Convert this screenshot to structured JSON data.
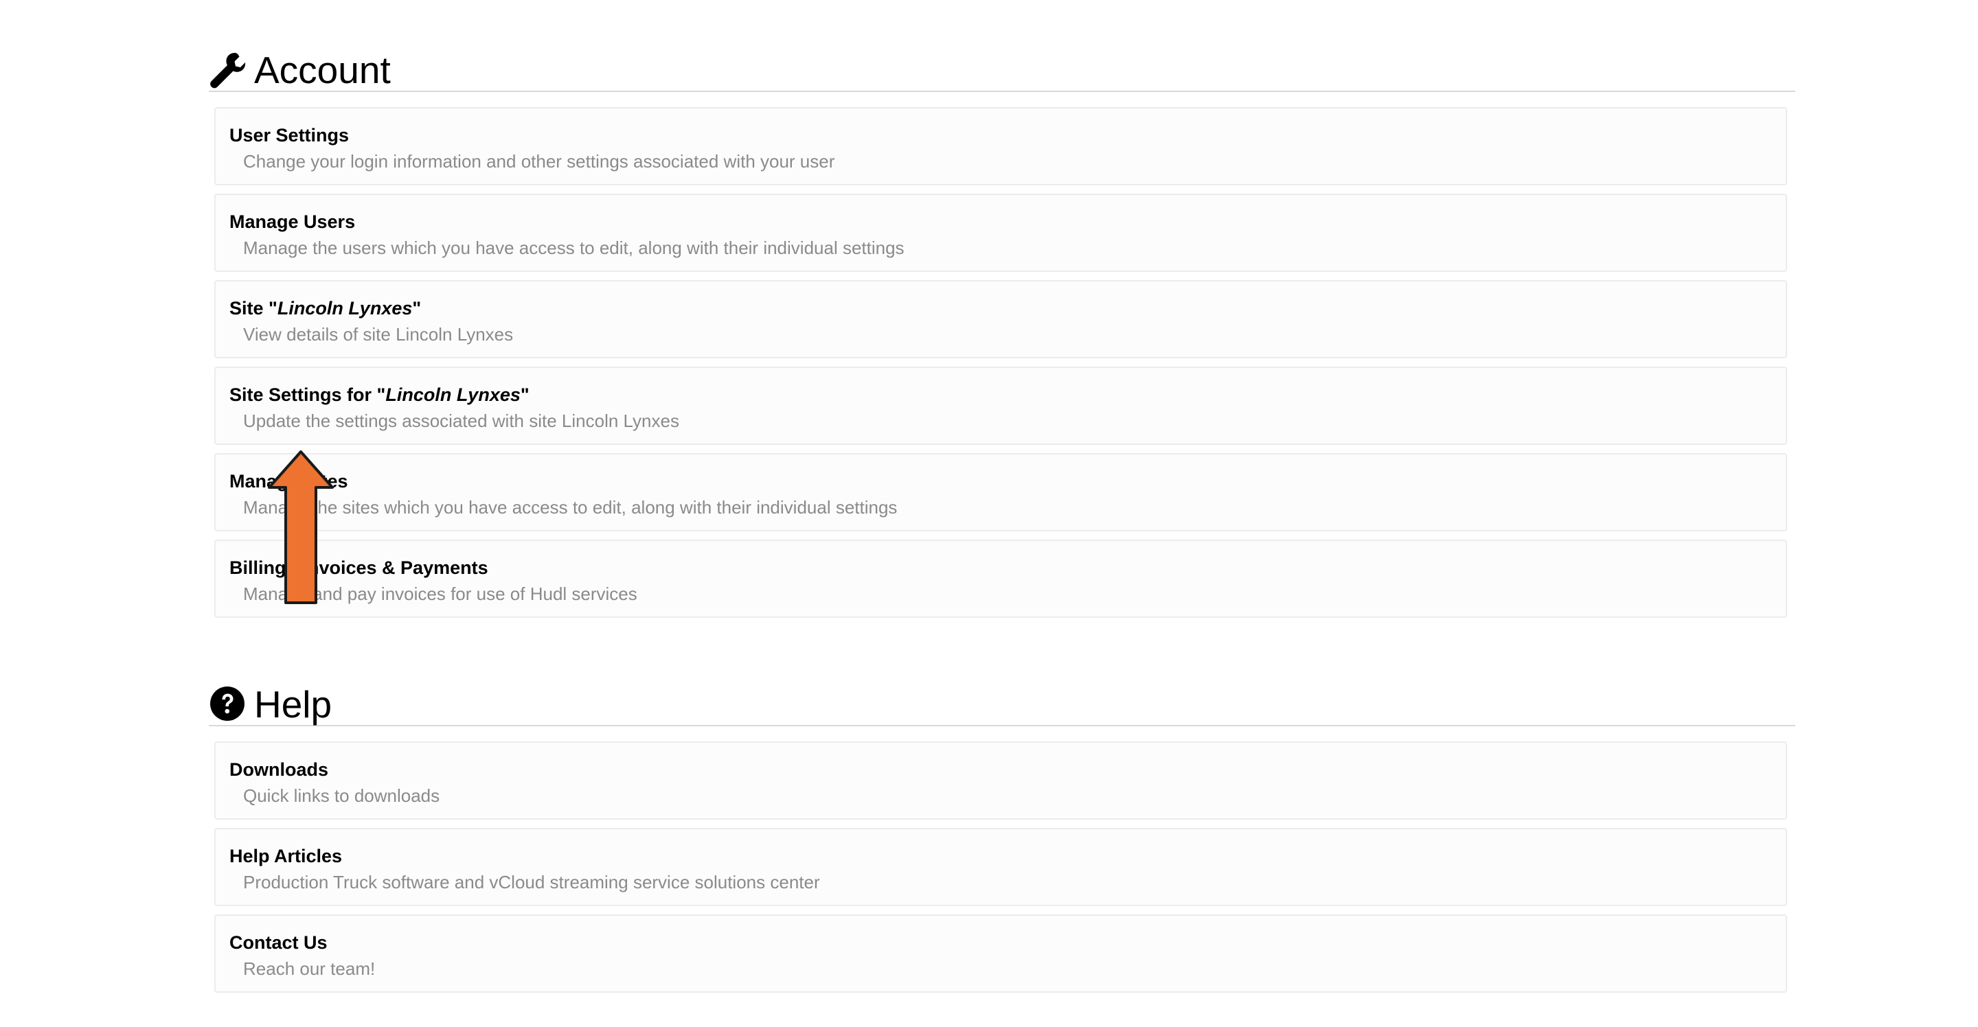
{
  "account": {
    "title": "Account",
    "icon": "wrench-icon",
    "items": [
      {
        "title": "User Settings",
        "description": "Change your login information and other settings associated with your user"
      },
      {
        "title": "Manage Users",
        "description": "Manage the users which you have access to edit, along with their individual settings"
      },
      {
        "title_prefix": "Site \"",
        "title_em": "Lincoln Lynxes",
        "title_suffix": "\"",
        "description": "View details of site Lincoln Lynxes"
      },
      {
        "title_prefix": "Site Settings for \"",
        "title_em": "Lincoln Lynxes",
        "title_suffix": "\"",
        "description": "Update the settings associated with site Lincoln Lynxes"
      },
      {
        "title": "Manage Sites",
        "description": "Manage the sites which you have access to edit, along with their individual settings"
      },
      {
        "title": "Billing - Invoices & Payments",
        "description": "Manage and pay invoices for use of Hudl services"
      }
    ]
  },
  "help": {
    "title": "Help",
    "icon": "question-circle-icon",
    "items": [
      {
        "title": "Downloads",
        "description": "Quick links to downloads"
      },
      {
        "title": "Help Articles",
        "description": "Production Truck software and vCloud streaming service solutions center"
      },
      {
        "title": "Contact Us",
        "description": "Reach our team!"
      }
    ]
  },
  "overlay": {
    "icon": "up-arrow-icon",
    "color": "#ee7230"
  }
}
